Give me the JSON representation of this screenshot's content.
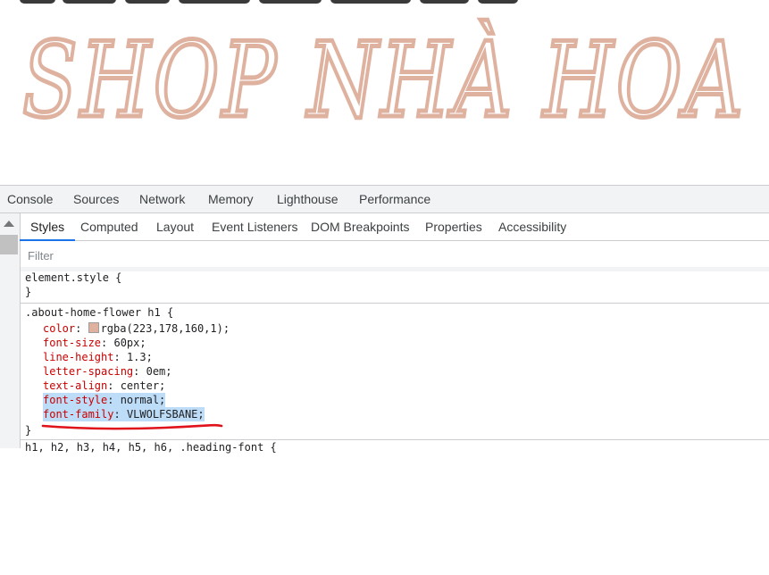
{
  "page": {
    "title_text": "SHOP NHÀ HOA",
    "title_color": "#dfb2a0"
  },
  "devtools": {
    "main_tabs": [
      "Console",
      "Sources",
      "Network",
      "Memory",
      "Lighthouse",
      "Performance"
    ],
    "sub_tabs": [
      "Styles",
      "Computed",
      "Layout",
      "Event Listeners",
      "DOM Breakpoints",
      "Properties",
      "Accessibility"
    ],
    "active_sub_tab": "Styles",
    "filter_placeholder": "Filter",
    "element_style": {
      "selector": "element.style {",
      "close": "}"
    },
    "rule": {
      "selector": ".about-home-flower h1 {",
      "close": "}",
      "declarations": [
        {
          "prop": "color",
          "value": "rgba(223,178,160,1);",
          "swatch": "#dfb2a0",
          "highlighted": false
        },
        {
          "prop": "font-size",
          "value": "60px;",
          "highlighted": false
        },
        {
          "prop": "line-height",
          "value": "1.3;",
          "highlighted": false
        },
        {
          "prop": "letter-spacing",
          "value": "0em;",
          "highlighted": false
        },
        {
          "prop": "text-align",
          "value": "center;",
          "highlighted": false
        },
        {
          "prop": "font-style",
          "value": "normal;",
          "highlighted": true
        },
        {
          "prop": "font-family",
          "value": "VLWOLFSBANE;",
          "highlighted": true
        }
      ]
    },
    "next_rule_partial": "h1, h2, h3, h4, h5, h6, .heading-font {",
    "annotation_color": "#e0121a",
    "accent_color": "#1a73e8"
  }
}
